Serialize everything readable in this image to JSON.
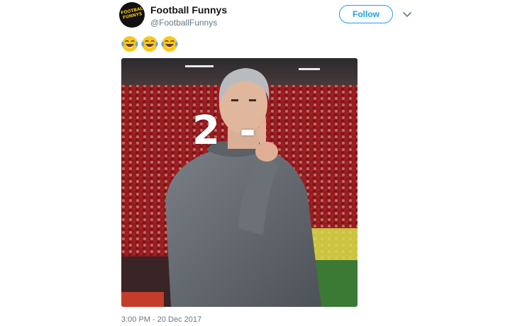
{
  "tweet": {
    "author": {
      "display_name": "Football Funnys",
      "handle": "@FootballFunnys",
      "avatar_text": "FOOTBALL FUNNYS",
      "avatar_bg": "#111111",
      "avatar_fg": "#f5c400"
    },
    "follow_label": "Follow",
    "menu_icon": "chevron-down-icon",
    "emoji_icon": "face-with-tears-of-joy-icon",
    "emoji_count": 3,
    "media": {
      "overlay_text": "2 -",
      "icon": "photo-shush-gesture"
    },
    "timestamp": "3:00 PM - 20 Dec 2017"
  },
  "colors": {
    "accent": "#1da1f2",
    "secondary_text": "#657786",
    "primary_text": "#14171a"
  }
}
